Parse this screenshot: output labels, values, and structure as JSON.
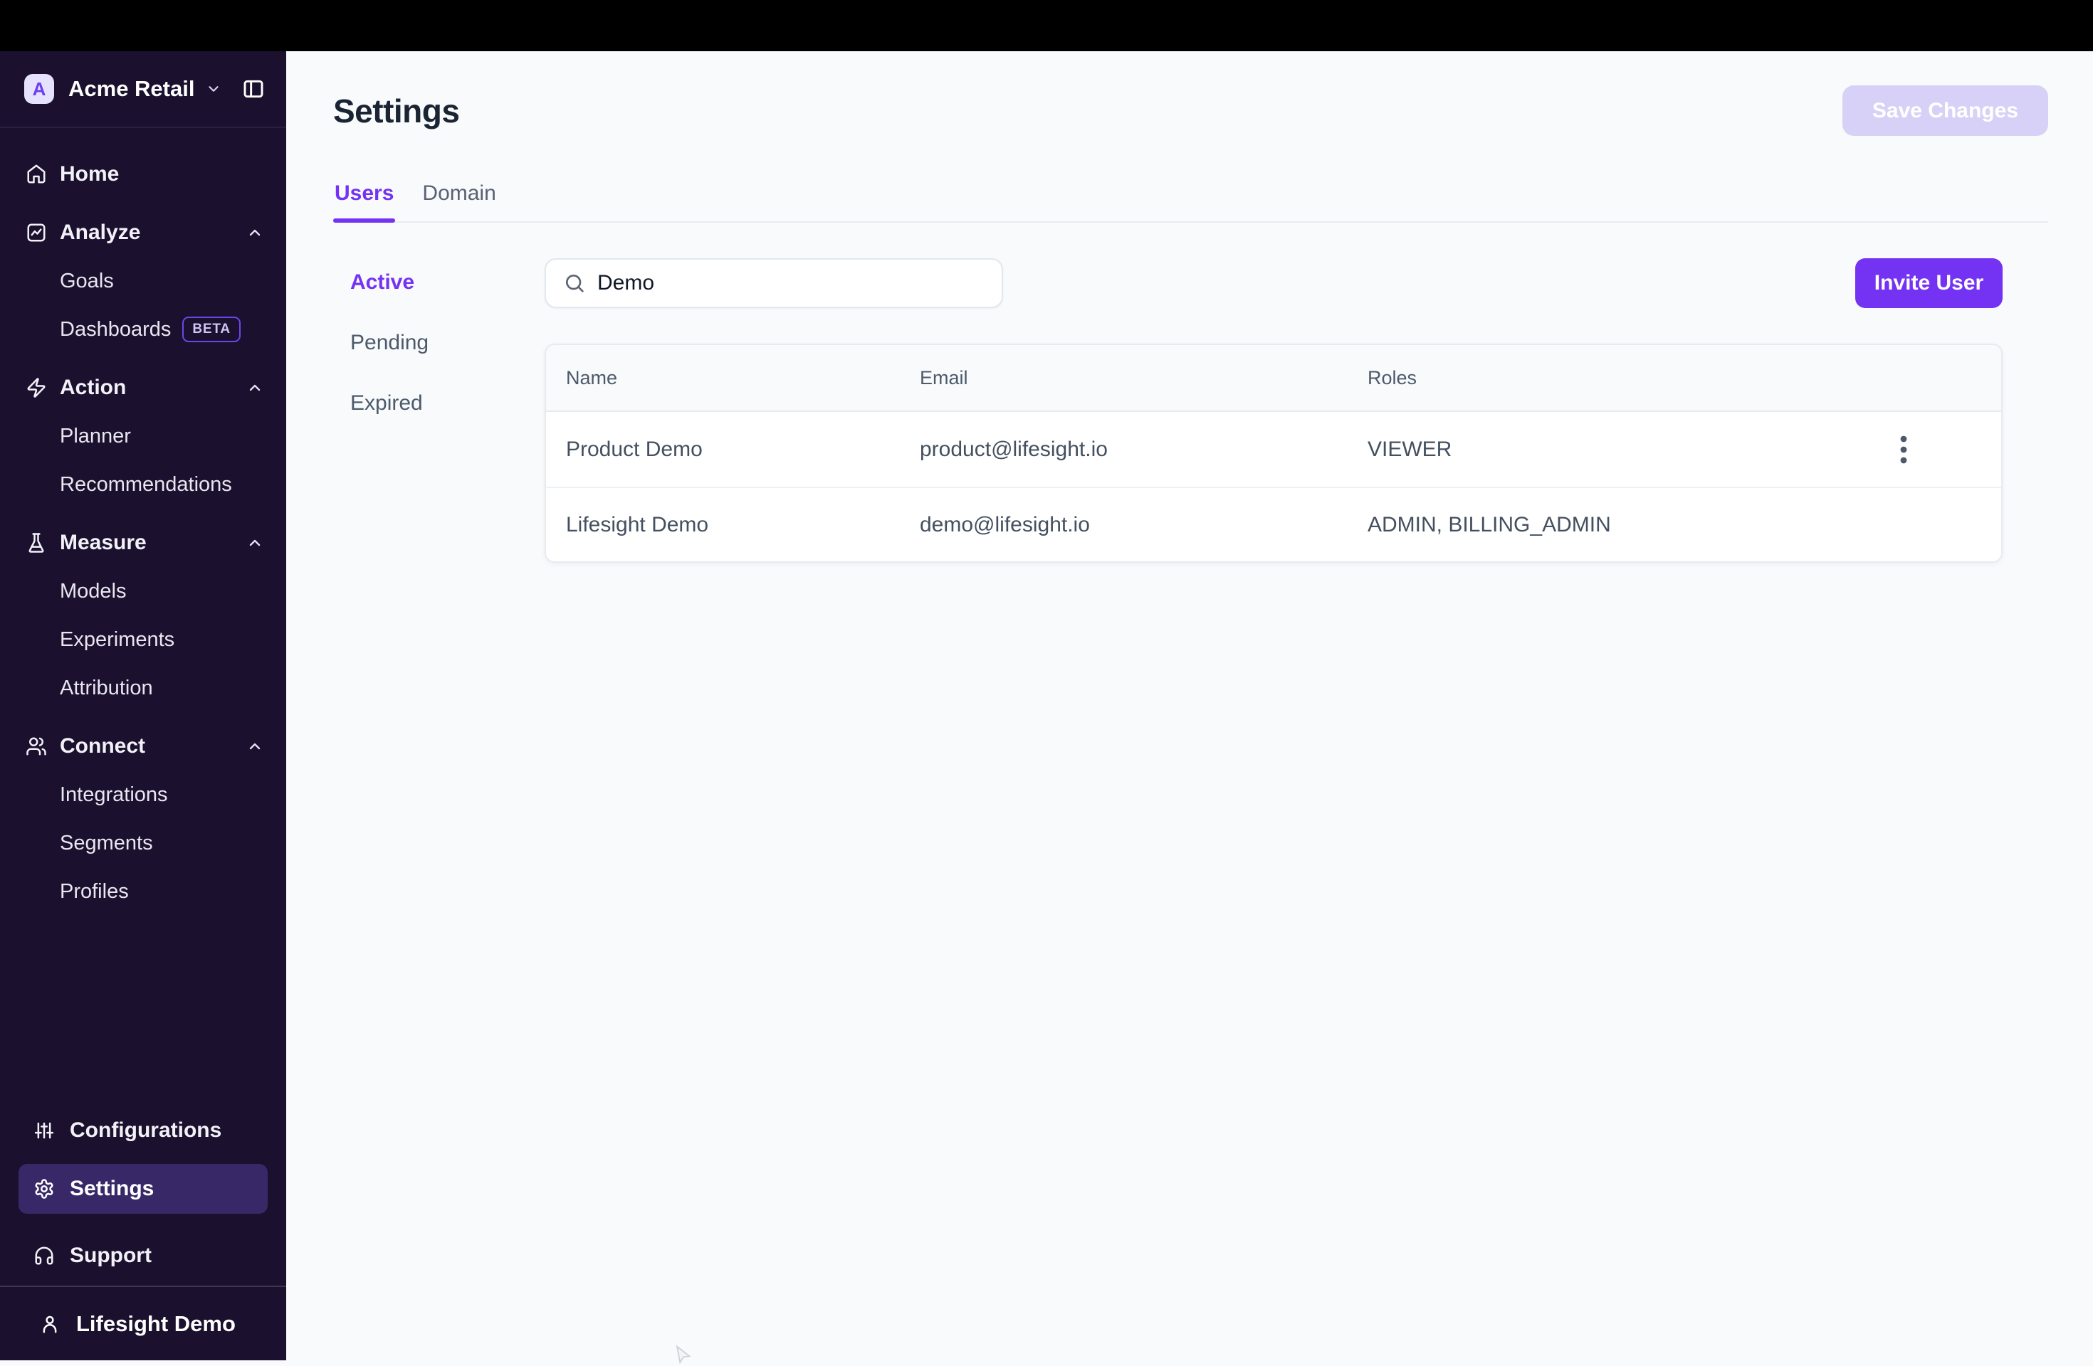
{
  "sidebar": {
    "workspace": {
      "initial": "A",
      "name": "Acme Retail"
    },
    "nav": [
      {
        "label": "Home"
      },
      {
        "label": "Analyze",
        "children": [
          {
            "label": "Goals"
          },
          {
            "label": "Dashboards",
            "badge": "BETA"
          }
        ]
      },
      {
        "label": "Action",
        "children": [
          {
            "label": "Planner"
          },
          {
            "label": "Recommendations"
          }
        ]
      },
      {
        "label": "Measure",
        "children": [
          {
            "label": "Models"
          },
          {
            "label": "Experiments"
          },
          {
            "label": "Attribution"
          }
        ]
      },
      {
        "label": "Connect",
        "children": [
          {
            "label": "Integrations"
          },
          {
            "label": "Segments"
          },
          {
            "label": "Profiles"
          }
        ]
      }
    ],
    "footer": [
      {
        "label": "Configurations"
      },
      {
        "label": "Settings",
        "active": true
      },
      {
        "label": "Support"
      }
    ],
    "user": {
      "name": "Lifesight Demo"
    }
  },
  "main": {
    "title": "Settings",
    "save_button": "Save Changes",
    "tabs": [
      {
        "label": "Users",
        "active": true
      },
      {
        "label": "Domain"
      }
    ],
    "filters": [
      {
        "label": "Active",
        "active": true
      },
      {
        "label": "Pending"
      },
      {
        "label": "Expired"
      }
    ],
    "search": {
      "value": "Demo"
    },
    "invite_button": "Invite User",
    "table": {
      "headers": [
        "Name",
        "Email",
        "Roles"
      ],
      "rows": [
        {
          "name": "Product Demo",
          "email": "product@lifesight.io",
          "roles": "VIEWER",
          "has_menu": true
        },
        {
          "name": "Lifesight Demo",
          "email": "demo@lifesight.io",
          "roles": "ADMIN, BILLING_ADMIN",
          "has_menu": false
        }
      ]
    }
  },
  "colors": {
    "accent": "#7433F2",
    "accent_disabled": "#D8D1F7",
    "sidebar_bg": "#1B102D",
    "sidebar_active_bg": "#382868",
    "topbar_bg": "#000000",
    "page_bg": "#F8FAFC",
    "border": "#E7EBF0",
    "text_dark": "#1A2433",
    "text_muted": "#4D5A6B"
  }
}
